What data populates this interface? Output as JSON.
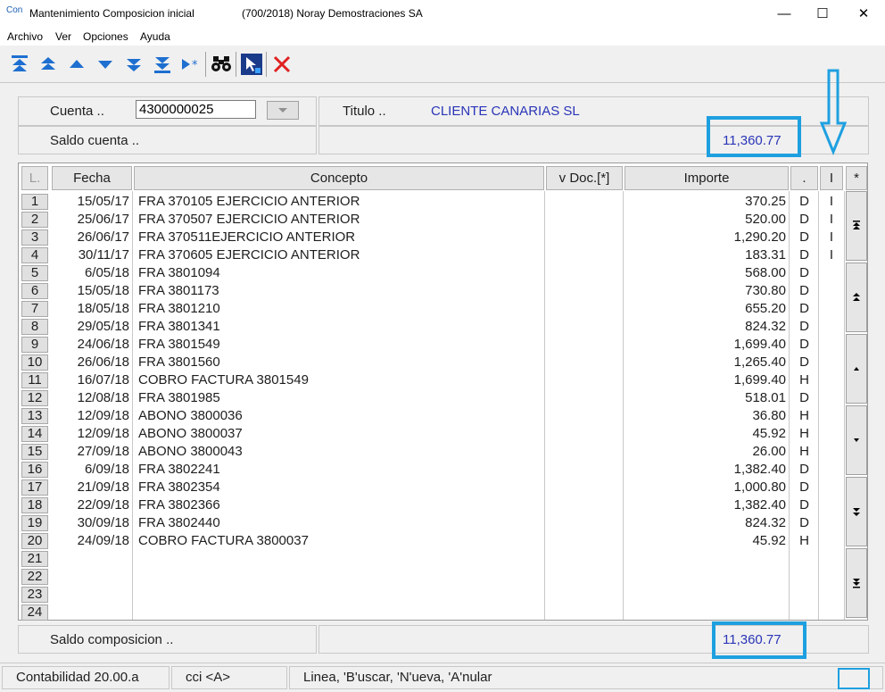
{
  "window": {
    "app_icon_text": "Con",
    "title": "Mantenimiento Composicion inicial",
    "company": "(700/2018) Noray Demostraciones SA",
    "minimize": "—",
    "maximize": "☐",
    "close": "✕"
  },
  "menu": [
    {
      "label": "Archivo"
    },
    {
      "label": "Ver"
    },
    {
      "label": "Opciones"
    },
    {
      "label": "Ayuda"
    }
  ],
  "toolbar": {
    "icons": [
      "first-icon",
      "page-up-icon",
      "up-icon",
      "down-icon",
      "page-down-icon",
      "last-icon",
      "insert-row-icon",
      "binoculars-icon",
      "select-icon",
      "delete-icon"
    ]
  },
  "header": {
    "cuenta_label": "Cuenta ..",
    "cuenta_value": "4300000025",
    "titulo_label": "Titulo ..",
    "titulo_value": "CLIENTE CANARIAS SL",
    "saldo_cuenta_label": "Saldo cuenta ..",
    "saldo_cuenta_value": "11,360.77"
  },
  "grid": {
    "columns": [
      "L.",
      "Fecha",
      "Concepto",
      "v Doc.[*]",
      "Importe",
      ".",
      "I",
      "*"
    ],
    "rows": [
      {
        "n": "1",
        "fecha": "15/05/17",
        "concepto": "FRA 370105 EJERCICIO ANTERIOR",
        "importe": "370.25",
        "dh": "D",
        "i": "I"
      },
      {
        "n": "2",
        "fecha": "25/06/17",
        "concepto": "FRA 370507 EJERCICIO ANTERIOR",
        "importe": "520.00",
        "dh": "D",
        "i": "I"
      },
      {
        "n": "3",
        "fecha": "26/06/17",
        "concepto": "FRA 370511EJERCICIO ANTERIOR",
        "importe": "1,290.20",
        "dh": "D",
        "i": "I"
      },
      {
        "n": "4",
        "fecha": "30/11/17",
        "concepto": "FRA 370605 EJERCICIO ANTERIOR",
        "importe": "183.31",
        "dh": "D",
        "i": "I"
      },
      {
        "n": "5",
        "fecha": "6/05/18",
        "concepto": "FRA 3801094",
        "importe": "568.00",
        "dh": "D",
        "i": ""
      },
      {
        "n": "6",
        "fecha": "15/05/18",
        "concepto": "FRA 3801173",
        "importe": "730.80",
        "dh": "D",
        "i": ""
      },
      {
        "n": "7",
        "fecha": "18/05/18",
        "concepto": "FRA 3801210",
        "importe": "655.20",
        "dh": "D",
        "i": ""
      },
      {
        "n": "8",
        "fecha": "29/05/18",
        "concepto": "FRA 3801341",
        "importe": "824.32",
        "dh": "D",
        "i": ""
      },
      {
        "n": "9",
        "fecha": "24/06/18",
        "concepto": "FRA 3801549",
        "importe": "1,699.40",
        "dh": "D",
        "i": ""
      },
      {
        "n": "10",
        "fecha": "26/06/18",
        "concepto": "FRA 3801560",
        "importe": "1,265.40",
        "dh": "D",
        "i": ""
      },
      {
        "n": "11",
        "fecha": "16/07/18",
        "concepto": "COBRO FACTURA 3801549",
        "importe": "1,699.40",
        "dh": "H",
        "i": ""
      },
      {
        "n": "12",
        "fecha": "12/08/18",
        "concepto": "FRA 3801985",
        "importe": "518.01",
        "dh": "D",
        "i": ""
      },
      {
        "n": "13",
        "fecha": "12/09/18",
        "concepto": "ABONO 3800036",
        "importe": "36.80",
        "dh": "H",
        "i": ""
      },
      {
        "n": "14",
        "fecha": "12/09/18",
        "concepto": "ABONO 3800037",
        "importe": "45.92",
        "dh": "H",
        "i": ""
      },
      {
        "n": "15",
        "fecha": "27/09/18",
        "concepto": "ABONO 3800043",
        "importe": "26.00",
        "dh": "H",
        "i": ""
      },
      {
        "n": "16",
        "fecha": "6/09/18",
        "concepto": "FRA 3802241",
        "importe": "1,382.40",
        "dh": "D",
        "i": ""
      },
      {
        "n": "17",
        "fecha": "21/09/18",
        "concepto": "FRA 3802354",
        "importe": "1,000.80",
        "dh": "D",
        "i": ""
      },
      {
        "n": "18",
        "fecha": "22/09/18",
        "concepto": "FRA 3802366",
        "importe": "1,382.40",
        "dh": "D",
        "i": ""
      },
      {
        "n": "19",
        "fecha": "30/09/18",
        "concepto": "FRA 3802440",
        "importe": "824.32",
        "dh": "D",
        "i": ""
      },
      {
        "n": "20",
        "fecha": "24/09/18",
        "concepto": "COBRO FACTURA 3800037",
        "importe": "45.92",
        "dh": "H",
        "i": ""
      },
      {
        "n": "21",
        "fecha": "",
        "concepto": "",
        "importe": "",
        "dh": "",
        "i": ""
      },
      {
        "n": "22",
        "fecha": "",
        "concepto": "",
        "importe": "",
        "dh": "",
        "i": ""
      },
      {
        "n": "23",
        "fecha": "",
        "concepto": "",
        "importe": "",
        "dh": "",
        "i": ""
      },
      {
        "n": "24",
        "fecha": "",
        "concepto": "",
        "importe": "",
        "dh": "",
        "i": ""
      }
    ]
  },
  "footer": {
    "saldo_composicion_label": "Saldo composicion ..",
    "saldo_composicion_value": "11,360.77"
  },
  "status": {
    "version": "Contabilidad 20.00.a",
    "cci": "cci <A>",
    "hint": "Linea, 'B'uscar, 'N'ueva, 'A'nular"
  },
  "colors": {
    "accent_blue": "#2a35b8",
    "highlight": "#1ea0e0",
    "delete_red": "#e02020"
  }
}
